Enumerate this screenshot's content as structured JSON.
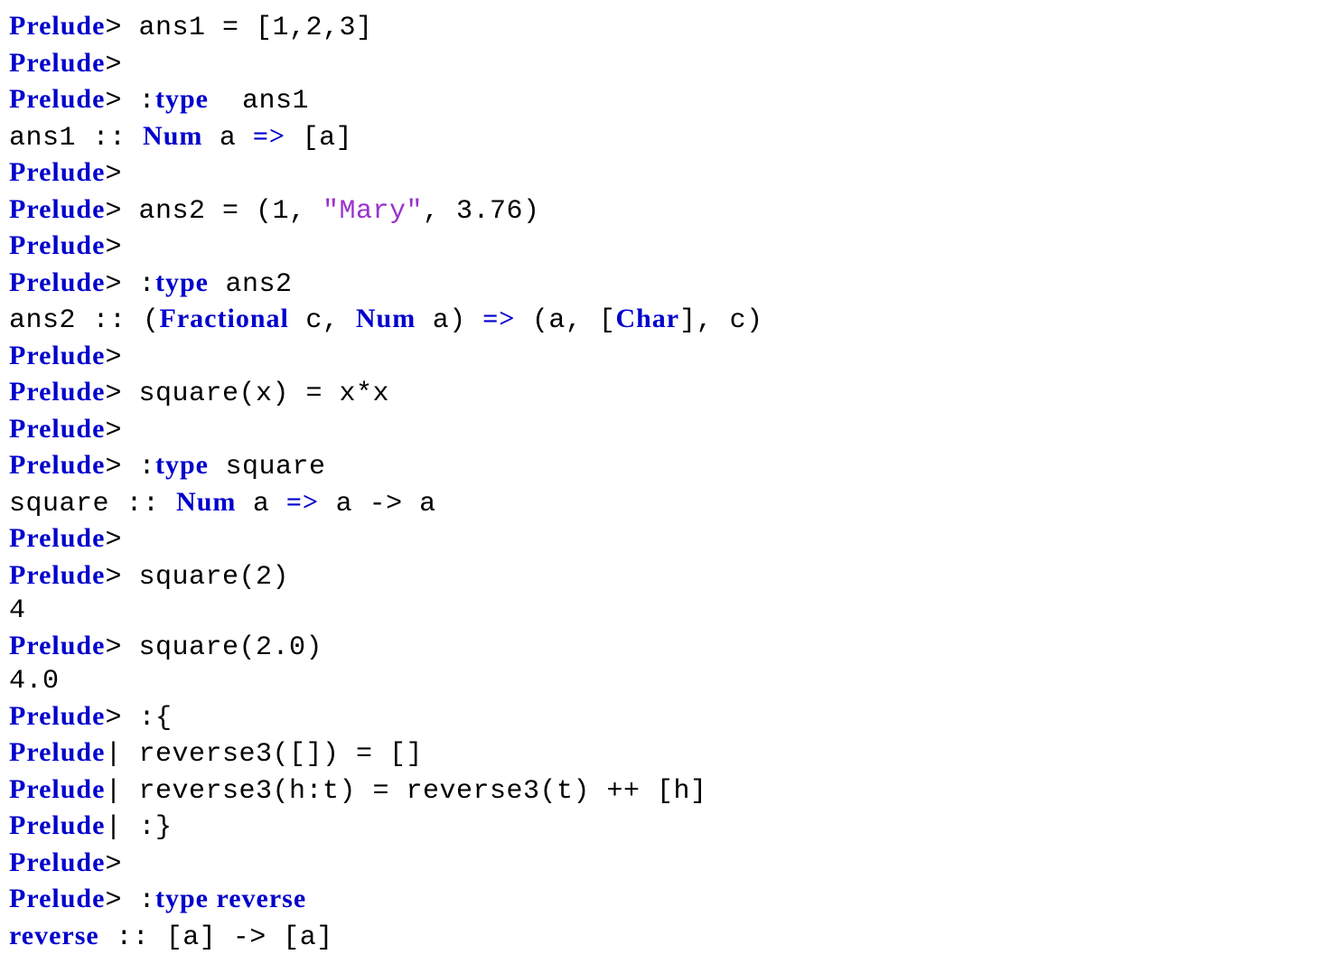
{
  "lines": [
    {
      "segments": [
        {
          "t": "Prelude",
          "c": "bold-blue"
        },
        {
          "t": "> ans1 = [1,2,3]"
        }
      ]
    },
    {
      "segments": [
        {
          "t": "Prelude",
          "c": "bold-blue"
        },
        {
          "t": ">"
        }
      ]
    },
    {
      "segments": [
        {
          "t": "Prelude",
          "c": "bold-blue"
        },
        {
          "t": "> :"
        },
        {
          "t": "type",
          "c": "bold-blue"
        },
        {
          "t": "  ans1"
        }
      ]
    },
    {
      "segments": [
        {
          "t": "ans1 :: "
        },
        {
          "t": "Num",
          "c": "bold-blue"
        },
        {
          "t": " a "
        },
        {
          "t": "=>",
          "c": "bold-blue"
        },
        {
          "t": " [a]"
        }
      ]
    },
    {
      "segments": [
        {
          "t": "Prelude",
          "c": "bold-blue"
        },
        {
          "t": ">"
        }
      ]
    },
    {
      "segments": [
        {
          "t": "Prelude",
          "c": "bold-blue"
        },
        {
          "t": "> ans2 = (1, "
        },
        {
          "t": "\"Mary\"",
          "c": "string"
        },
        {
          "t": ", 3.76)"
        }
      ]
    },
    {
      "segments": [
        {
          "t": "Prelude",
          "c": "bold-blue"
        },
        {
          "t": ">"
        }
      ]
    },
    {
      "segments": [
        {
          "t": "Prelude",
          "c": "bold-blue"
        },
        {
          "t": "> :"
        },
        {
          "t": "type",
          "c": "bold-blue"
        },
        {
          "t": " ans2"
        }
      ]
    },
    {
      "segments": [
        {
          "t": "ans2 :: ("
        },
        {
          "t": "Fractional",
          "c": "bold-blue"
        },
        {
          "t": " c, "
        },
        {
          "t": "Num",
          "c": "bold-blue"
        },
        {
          "t": " a) "
        },
        {
          "t": "=>",
          "c": "bold-blue"
        },
        {
          "t": " (a, ["
        },
        {
          "t": "Char",
          "c": "bold-blue"
        },
        {
          "t": "], c)"
        }
      ]
    },
    {
      "segments": [
        {
          "t": "Prelude",
          "c": "bold-blue"
        },
        {
          "t": ">"
        }
      ]
    },
    {
      "segments": [
        {
          "t": "Prelude",
          "c": "bold-blue"
        },
        {
          "t": "> square(x) = x*x"
        }
      ]
    },
    {
      "segments": [
        {
          "t": "Prelude",
          "c": "bold-blue"
        },
        {
          "t": ">"
        }
      ]
    },
    {
      "segments": [
        {
          "t": "Prelude",
          "c": "bold-blue"
        },
        {
          "t": "> :"
        },
        {
          "t": "type",
          "c": "bold-blue"
        },
        {
          "t": " square"
        }
      ]
    },
    {
      "segments": [
        {
          "t": "square :: "
        },
        {
          "t": "Num",
          "c": "bold-blue"
        },
        {
          "t": " a "
        },
        {
          "t": "=>",
          "c": "bold-blue"
        },
        {
          "t": " a -> a"
        }
      ]
    },
    {
      "segments": [
        {
          "t": "Prelude",
          "c": "bold-blue"
        },
        {
          "t": ">"
        }
      ]
    },
    {
      "segments": [
        {
          "t": "Prelude",
          "c": "bold-blue"
        },
        {
          "t": "> square(2)"
        }
      ]
    },
    {
      "segments": [
        {
          "t": "4"
        }
      ]
    },
    {
      "segments": [
        {
          "t": "Prelude",
          "c": "bold-blue"
        },
        {
          "t": "> square(2.0)"
        }
      ]
    },
    {
      "segments": [
        {
          "t": "4.0"
        }
      ]
    },
    {
      "segments": [
        {
          "t": "Prelude",
          "c": "bold-blue"
        },
        {
          "t": "> :{"
        }
      ]
    },
    {
      "segments": [
        {
          "t": "Prelude",
          "c": "bold-blue"
        },
        {
          "t": "| reverse3([]) = []"
        }
      ]
    },
    {
      "segments": [
        {
          "t": "Prelude",
          "c": "bold-blue"
        },
        {
          "t": "| reverse3(h:t) = reverse3(t) ++ [h]"
        }
      ]
    },
    {
      "segments": [
        {
          "t": "Prelude",
          "c": "bold-blue"
        },
        {
          "t": "| :}"
        }
      ]
    },
    {
      "segments": [
        {
          "t": "Prelude",
          "c": "bold-blue"
        },
        {
          "t": ">"
        }
      ]
    },
    {
      "segments": [
        {
          "t": "Prelude",
          "c": "bold-blue"
        },
        {
          "t": "> :"
        },
        {
          "t": "type reverse",
          "c": "bold-blue"
        }
      ]
    },
    {
      "segments": [
        {
          "t": "reverse",
          "c": "bold-blue"
        },
        {
          "t": " :: [a] -> [a]"
        }
      ]
    }
  ]
}
